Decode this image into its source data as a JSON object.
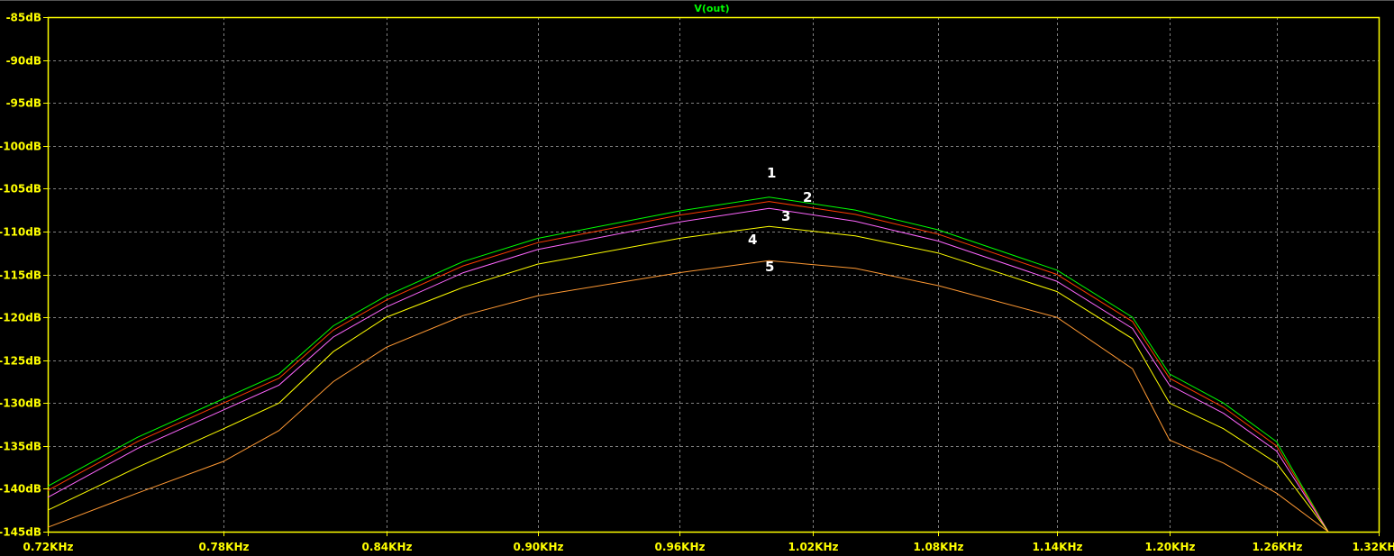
{
  "chart_data": {
    "type": "line",
    "title": "V(out)",
    "xscale": "log",
    "xlim": [
      0.72,
      1.32
    ],
    "ylim": [
      -145,
      -85
    ],
    "xunit": "KHz",
    "yunit": "dB",
    "grid": true,
    "xticks": [
      "0.72KHz",
      "0.78KHz",
      "0.84KHz",
      "0.90KHz",
      "0.96KHz",
      "1.02KHz",
      "1.08KHz",
      "1.14KHz",
      "1.20KHz",
      "1.26KHz",
      "1.32KH"
    ],
    "xtick_values": [
      0.72,
      0.78,
      0.84,
      0.9,
      0.96,
      1.02,
      1.08,
      1.14,
      1.2,
      1.26,
      1.32
    ],
    "yticks": [
      "-85dB",
      "-90dB",
      "-95dB",
      "-100dB",
      "-105dB",
      "-110dB",
      "-115dB",
      "-120dB",
      "-125dB",
      "-130dB",
      "-135dB",
      "-140dB",
      "-145dB"
    ],
    "ytick_values": [
      -85,
      -90,
      -95,
      -100,
      -105,
      -110,
      -115,
      -120,
      -125,
      -130,
      -135,
      -140,
      -145
    ],
    "x": [
      0.72,
      0.75,
      0.78,
      0.8,
      0.82,
      0.84,
      0.87,
      0.9,
      0.96,
      1.0,
      1.04,
      1.08,
      1.14,
      1.18,
      1.2,
      1.23,
      1.26,
      1.29
    ],
    "series": [
      {
        "name": "1",
        "color": "#00ff00",
        "values": [
          -139.7,
          -134,
          -129.5,
          -126.6,
          -121,
          -117.5,
          -113.5,
          -110.8,
          -107.6,
          -106,
          -107.5,
          -109.8,
          -114.5,
          -120,
          -126.6,
          -130,
          -134.5,
          -145.5
        ]
      },
      {
        "name": "2",
        "color": "#ff3c00",
        "values": [
          -140.2,
          -134.5,
          -130,
          -127.1,
          -121.5,
          -118,
          -114,
          -111.3,
          -108.1,
          -106.5,
          -108,
          -110.3,
          -115,
          -120.5,
          -127.1,
          -130.5,
          -135,
          -145.5
        ]
      },
      {
        "name": "3",
        "color": "#ff66ff",
        "values": [
          -141,
          -135.3,
          -130.8,
          -127.9,
          -122.3,
          -118.8,
          -114.8,
          -112.1,
          -108.9,
          -107.3,
          -108.8,
          -111.1,
          -115.8,
          -121.3,
          -127.9,
          -131.2,
          -135.6,
          -145.5
        ]
      },
      {
        "name": "4",
        "color": "#ffff00",
        "values": [
          -142.5,
          -137.5,
          -133,
          -130,
          -124,
          -120,
          -116.5,
          -113.8,
          -110.8,
          -109.4,
          -110.5,
          -112.5,
          -117,
          -122.5,
          -130,
          -133,
          -137,
          -145.5
        ]
      },
      {
        "name": "5",
        "color": "#ff9933",
        "values": [
          -144.5,
          -140.5,
          -136.8,
          -133.2,
          -127.5,
          -123.5,
          -119.8,
          -117.5,
          -114.8,
          -113.4,
          -114.3,
          -116.3,
          -120,
          -126,
          -134.3,
          -137,
          -140.5,
          -145.5
        ]
      }
    ],
    "annotations": [
      "1",
      "2",
      "3",
      "4",
      "5"
    ]
  }
}
